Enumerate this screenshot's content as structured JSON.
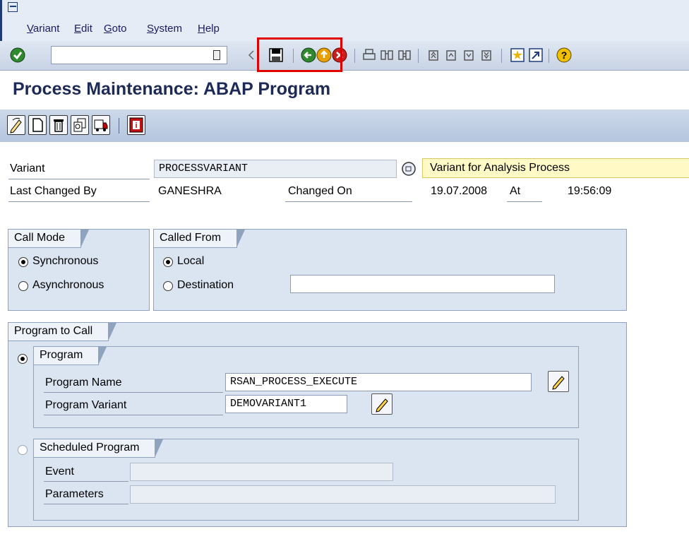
{
  "menubar": {
    "items": [
      "Variant",
      "Edit",
      "Goto",
      "System",
      "Help"
    ]
  },
  "toolbar": {
    "command_field_value": "",
    "icons": [
      "enter-icon",
      "save-icon",
      "back-icon",
      "exit-icon",
      "cancel-icon",
      "print-icon",
      "find-icon",
      "find-next-icon",
      "first-page-icon",
      "previous-page-icon",
      "next-page-icon",
      "last-page-icon",
      "create-session-icon",
      "shortcut-icon",
      "help-icon"
    ]
  },
  "page": {
    "title": "Process Maintenance: ABAP Program"
  },
  "app_toolbar": {
    "icons": [
      "change-icon",
      "create-icon",
      "delete-icon",
      "copy-icon",
      "transport-icon",
      "info-icon"
    ]
  },
  "header": {
    "variant_label": "Variant",
    "variant_value": "PROCESSVARIANT",
    "variant_desc": "Variant for Analysis Process",
    "last_changed_label": "Last Changed By",
    "last_changed_value": "GANESHRA",
    "changed_on_label": "Changed On",
    "changed_on_value": "19.07.2008",
    "at_label": "At",
    "at_value": "19:56:09"
  },
  "call_mode": {
    "title": "Call Mode",
    "options": [
      "Synchronous",
      "Asynchronous"
    ],
    "selected": "Synchronous"
  },
  "called_from": {
    "title": "Called From",
    "options": [
      "Local",
      "Destination"
    ],
    "selected": "Local",
    "destination_value": ""
  },
  "program_to_call": {
    "title": "Program to Call",
    "program": {
      "title": "Program",
      "name_label": "Program Name",
      "name_value": "RSAN_PROCESS_EXECUTE",
      "variant_label": "Program Variant",
      "variant_value": "DEMOVARIANT1"
    },
    "scheduled": {
      "title": "Scheduled Program",
      "event_label": "Event",
      "event_value": "",
      "parameters_label": "Parameters",
      "parameters_value": ""
    },
    "selected": "Program"
  },
  "colors": {
    "highlight": "#e00000",
    "title": "#1d2a55",
    "group_bg": "#dbe5f1",
    "desc_bg": "#fff9c6"
  }
}
